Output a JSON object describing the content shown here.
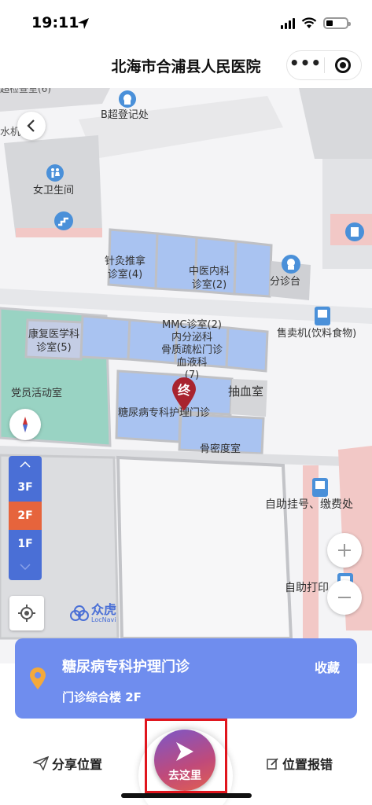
{
  "status_bar": {
    "time": "19:11"
  },
  "header": {
    "title": "北海市合浦县人民医院"
  },
  "map": {
    "labels": {
      "b_ultrasound": "B超登记处",
      "women_restroom": "女卫生间",
      "acupuncture": "针灸推拿\n诊室(4)",
      "tcm": "中医内科\n诊室(2)",
      "triage": "分诊台",
      "vending": "售卖机(饮料食物)",
      "rehab": "康复医学科\n诊室(5)",
      "mmc": "MMC诊室(2)\n内分泌科\n骨质疏松门诊\n血液科\n(7)",
      "blood_draw": "抽血室",
      "party_room": "党员活动室",
      "diabetes_clinic": "糖尿病专科护理门诊",
      "bone_density": "骨密度室",
      "self_register": "自助挂号、缴费处",
      "self_print": "自助打印",
      "partial_top": "超检查室(6)",
      "partial_left": "水机"
    },
    "end_marker": "终",
    "floors": [
      "3F",
      "2F",
      "1F"
    ],
    "active_floor": "2F",
    "logo_text": "众虎",
    "logo_subtext": "LocNavi"
  },
  "info_card": {
    "name": "糖尿病专科护理门诊",
    "favorite_label": "收藏",
    "location": "门诊综合楼 2F"
  },
  "bottom_bar": {
    "share_label": "分享位置",
    "go_label": "去这里",
    "report_label": "位置报错"
  },
  "colors": {
    "room_blue": "#a9c3f1",
    "room_teal": "#99d3c3",
    "accent_blue": "#6f8dee",
    "floor_active": "#e6643c",
    "marker_red": "#a8232e",
    "highlight_red": "#e0151d"
  }
}
